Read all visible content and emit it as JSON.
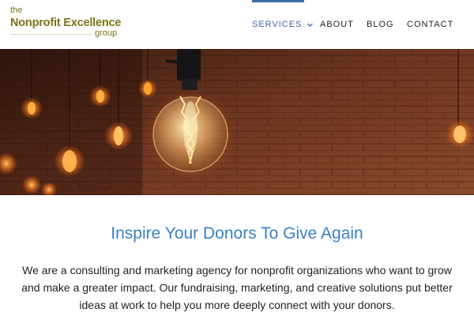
{
  "logo": {
    "line1": "the",
    "line2": "Nonprofit Excellence",
    "line3": "group"
  },
  "nav": {
    "items": [
      {
        "label": "SERVICES",
        "active": true,
        "has_dropdown": true
      },
      {
        "label": "ABOUT",
        "active": false
      },
      {
        "label": "BLOG",
        "active": false
      },
      {
        "label": "CONTACT",
        "active": false
      }
    ]
  },
  "main": {
    "heading": "Inspire Your Donors To Give Again",
    "intro": "We are a consulting and marketing agency for nonprofit organizations who want to grow and make a greater impact.  Our fundraising, marketing, and creative solutions put better ideas at work to help you more deeply connect with your donors."
  },
  "colors": {
    "brand_olive": "#7c7316",
    "accent_blue": "#3b6aa8",
    "heading_blue": "#3a80c8"
  },
  "icons": {
    "dropdown": "chevron-down-icon"
  }
}
